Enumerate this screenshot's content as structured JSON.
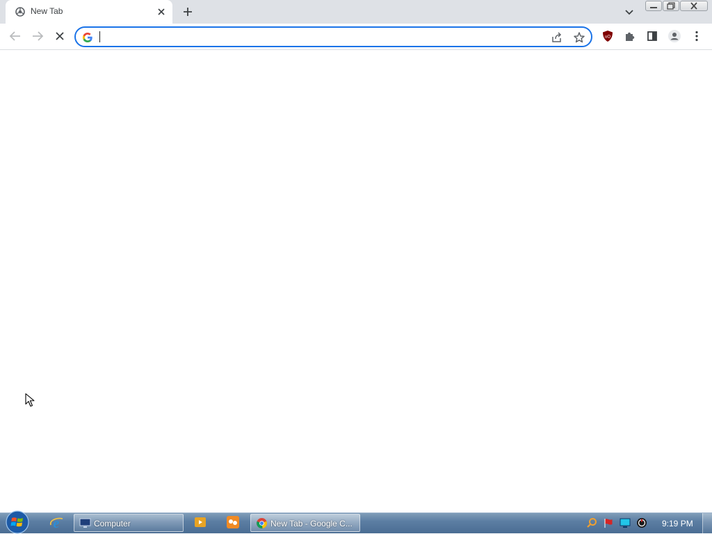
{
  "browser": {
    "tab": {
      "title": "New Tab",
      "favicon": "chrome-newtab-icon"
    },
    "tab_strip_icons": {
      "close_tab": "close-icon",
      "new_tab": "plus-icon",
      "tab_search": "chevron-down-icon"
    },
    "toolbar_icons": {
      "back": "arrow-left-icon",
      "forward": "arrow-right-icon",
      "stop": "close-icon",
      "share": "share-icon",
      "bookmark": "star-icon",
      "ublock": "ublock-origin-icon",
      "extensions": "puzzle-icon",
      "side_panel": "side-panel-icon",
      "profile": "person-icon",
      "menu": "kebab-menu-icon"
    },
    "omnibox": {
      "value": "",
      "placeholder": "",
      "search_engine_icon": "google-g-icon"
    }
  },
  "taskbar": {
    "start": "windows-logo-icon",
    "quick_launch": [
      "internet-explorer-icon"
    ],
    "tasks": [
      {
        "label": "Computer",
        "icon": "computer-icon",
        "active": false
      },
      {
        "label": "New Tab - Google C...",
        "icon": "chrome-icon",
        "active": true
      }
    ],
    "pinned": [
      "media-player-icon",
      "app-icon"
    ],
    "tray": [
      "search-icon",
      "flag-icon",
      "monitor-icon",
      "power-icon"
    ],
    "clock": "9:19 PM"
  },
  "colors": {
    "accent": "#1a73e8",
    "tabstrip": "#dee1e6",
    "taskbar": "#5c7ea3",
    "ublock": "#800000"
  }
}
